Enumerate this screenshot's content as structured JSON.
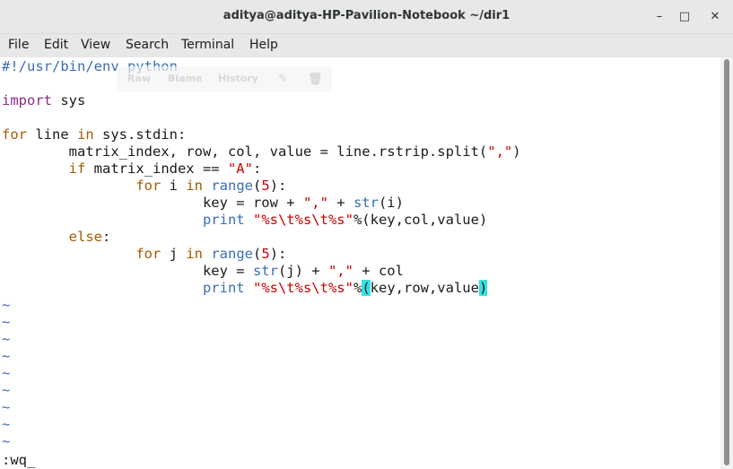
{
  "window": {
    "title": "aditya@aditya-HP-Pavilion-Notebook ~/dir1",
    "controls": {
      "minimize": "–",
      "maximize": "□",
      "close": "✕"
    }
  },
  "menubar": {
    "items": [
      "File",
      "Edit",
      "View",
      "Search",
      "Terminal",
      "Help"
    ]
  },
  "ghost_toolbar": [
    "Raw",
    "Blame",
    "History"
  ],
  "editor": {
    "lines": [
      [
        {
          "t": "#!/usr/bin/env python",
          "c": "blue"
        }
      ],
      [],
      [
        {
          "t": "import",
          "c": "kw-purple"
        },
        {
          "t": " sys",
          "c": ""
        }
      ],
      [],
      [
        {
          "t": "for",
          "c": "kw-brown"
        },
        {
          "t": " line ",
          "c": ""
        },
        {
          "t": "in",
          "c": "kw-brown"
        },
        {
          "t": " sys.stdin:",
          "c": ""
        }
      ],
      [
        {
          "t": "        matrix_index, row, col, value = line.rstrip.split(",
          "c": ""
        },
        {
          "t": "\",\"",
          "c": "str"
        },
        {
          "t": ")",
          "c": ""
        }
      ],
      [
        {
          "t": "        ",
          "c": ""
        },
        {
          "t": "if",
          "c": "kw-brown"
        },
        {
          "t": " matrix_index == ",
          "c": ""
        },
        {
          "t": "\"A\"",
          "c": "str"
        },
        {
          "t": ":",
          "c": ""
        }
      ],
      [
        {
          "t": "                ",
          "c": ""
        },
        {
          "t": "for",
          "c": "kw-brown"
        },
        {
          "t": " i ",
          "c": ""
        },
        {
          "t": "in",
          "c": "kw-brown"
        },
        {
          "t": " ",
          "c": ""
        },
        {
          "t": "range",
          "c": "blue"
        },
        {
          "t": "(",
          "c": ""
        },
        {
          "t": "5",
          "c": "str"
        },
        {
          "t": "):",
          "c": ""
        }
      ],
      [
        {
          "t": "                        key = row + ",
          "c": ""
        },
        {
          "t": "\",\"",
          "c": "str"
        },
        {
          "t": " + ",
          "c": ""
        },
        {
          "t": "str",
          "c": "blue"
        },
        {
          "t": "(i)",
          "c": ""
        }
      ],
      [
        {
          "t": "                        ",
          "c": ""
        },
        {
          "t": "print",
          "c": "blue"
        },
        {
          "t": " ",
          "c": ""
        },
        {
          "t": "\"%s\\t%s\\t%s\"",
          "c": "str"
        },
        {
          "t": "%(key,col,value)",
          "c": ""
        }
      ],
      [
        {
          "t": "        ",
          "c": ""
        },
        {
          "t": "else",
          "c": "kw-brown"
        },
        {
          "t": ":",
          "c": ""
        }
      ],
      [
        {
          "t": "                ",
          "c": ""
        },
        {
          "t": "for",
          "c": "kw-brown"
        },
        {
          "t": " j ",
          "c": ""
        },
        {
          "t": "in",
          "c": "kw-brown"
        },
        {
          "t": " ",
          "c": ""
        },
        {
          "t": "range",
          "c": "blue"
        },
        {
          "t": "(",
          "c": ""
        },
        {
          "t": "5",
          "c": "str"
        },
        {
          "t": "):",
          "c": ""
        }
      ],
      [
        {
          "t": "                        key = ",
          "c": ""
        },
        {
          "t": "str",
          "c": "blue"
        },
        {
          "t": "(j) + ",
          "c": ""
        },
        {
          "t": "\",\"",
          "c": "str"
        },
        {
          "t": " + col",
          "c": ""
        }
      ],
      [
        {
          "t": "                        ",
          "c": ""
        },
        {
          "t": "print",
          "c": "blue"
        },
        {
          "t": " ",
          "c": ""
        },
        {
          "t": "\"%s\\t%s\\t%s\"",
          "c": "str"
        },
        {
          "t": "%",
          "c": ""
        },
        {
          "t": "(",
          "c": "paren-hl"
        },
        {
          "t": "key,row,value",
          "c": ""
        },
        {
          "t": ")",
          "c": "paren-hl"
        }
      ]
    ],
    "tildes": [
      "~",
      "~",
      "~",
      "~",
      "~",
      "~",
      "~",
      "~",
      "~"
    ],
    "command_line": ":wq_"
  },
  "colors": {
    "keyword_purple": "#8b2a8e",
    "keyword_brown": "#a55a00",
    "string": "#cc0000",
    "builtin_blue": "#3a6db7",
    "paren_highlight": "#34e2e2"
  }
}
